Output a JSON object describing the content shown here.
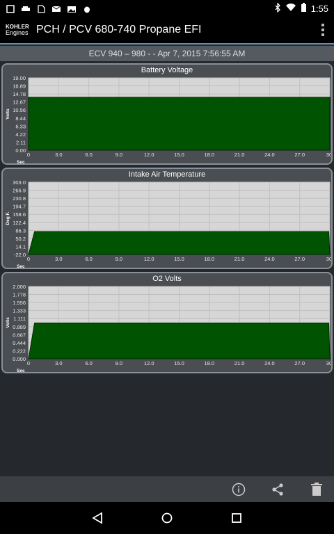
{
  "status": {
    "time": "1:55",
    "left_icons": [
      "tablet-icon",
      "car-icon",
      "sd-card-icon",
      "gmail-icon",
      "photo-icon",
      "android-debug-icon"
    ],
    "right_icons": [
      "bluetooth-icon",
      "wifi-icon",
      "battery-icon"
    ]
  },
  "appbar": {
    "logo_line1": "KOHLER",
    "logo_line2": "Engines",
    "title": "PCH / PCV 680-740 Propane EFI"
  },
  "subtitle": "ECV 940 – 980 -  - Apr 7, 2015 7:56:55 AM",
  "chart_data": [
    {
      "type": "area",
      "title": "Battery Voltage",
      "ylabel": "Volts",
      "xlabel": "Sec",
      "yticks": [
        "19.00",
        "16.89",
        "14.78",
        "12.67",
        "10.56",
        "8.44",
        "6.33",
        "4.22",
        "2.11",
        "0.00"
      ],
      "xticks": [
        "0",
        "3.0",
        "6.0",
        "9.0",
        "12.0",
        "15.0",
        "18.0",
        "21.0",
        "24.0",
        "27.0",
        "30."
      ],
      "xlim": [
        0,
        30
      ],
      "ylim": [
        0,
        19
      ],
      "x": [
        0,
        0.1,
        30
      ],
      "values": [
        13.9,
        13.9,
        13.9
      ]
    },
    {
      "type": "area",
      "title": "Intake Air Temperature",
      "ylabel": "Deg F.",
      "xlabel": "Sec",
      "yticks": [
        "303.0",
        "266.9",
        "230.8",
        "194.7",
        "158.6",
        "122.4",
        "86.3",
        "50.2",
        "14.1",
        "-22.0"
      ],
      "xticks": [
        "0",
        "3.0",
        "6.0",
        "9.0",
        "12.0",
        "15.0",
        "18.0",
        "21.0",
        "24.0",
        "27.0",
        "30."
      ],
      "xlim": [
        0,
        30
      ],
      "ylim": [
        -22,
        303
      ],
      "x": [
        0,
        0.6,
        29.9,
        30
      ],
      "values": [
        -22,
        81,
        81,
        -22
      ]
    },
    {
      "type": "area",
      "title": "O2 Volts",
      "ylabel": "Volts",
      "xlabel": "Sec",
      "yticks": [
        "2.000",
        "1.778",
        "1.556",
        "1.333",
        "1.111",
        "0.889",
        "0.667",
        "0.444",
        "0.222",
        "0.000"
      ],
      "xticks": [
        "0",
        "3.0",
        "6.0",
        "9.0",
        "12.0",
        "15.0",
        "18.0",
        "21.0",
        "24.0",
        "27.0",
        "30."
      ],
      "xlim": [
        0,
        30
      ],
      "ylim": [
        0,
        2
      ],
      "x": [
        0,
        0.6,
        29.9,
        30
      ],
      "values": [
        0,
        0.99,
        0.99,
        0
      ]
    }
  ],
  "colors": {
    "fill": "#005300",
    "grid": "#bfbfbf",
    "plot_bg": "#d6d6d6"
  }
}
